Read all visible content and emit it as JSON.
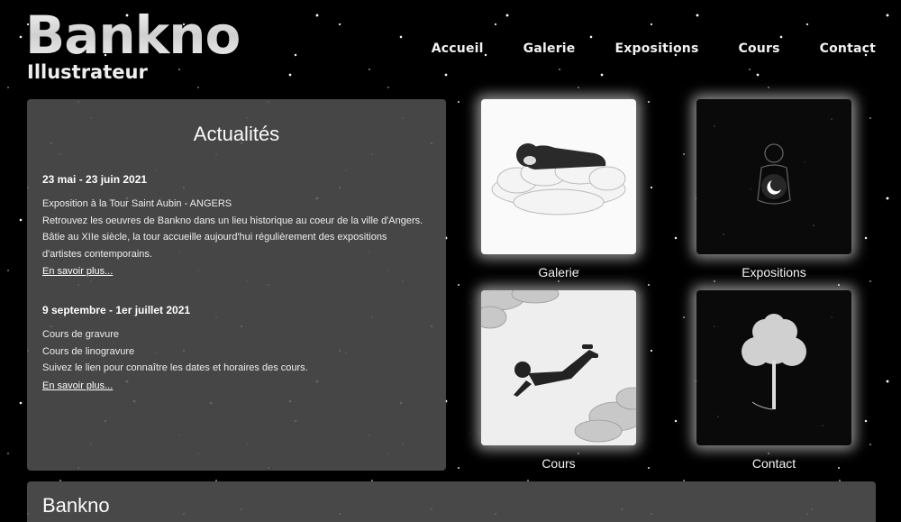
{
  "header": {
    "title": "Bankno",
    "subtitle": "Illustrateur"
  },
  "nav": {
    "items": [
      {
        "label": "Accueil"
      },
      {
        "label": "Galerie"
      },
      {
        "label": "Expositions"
      },
      {
        "label": "Cours"
      },
      {
        "label": "Contact"
      }
    ]
  },
  "news": {
    "heading": "Actualités",
    "items": [
      {
        "date": "23 mai - 23 juin 2021",
        "lines": [
          "Exposition à la Tour Saint Aubin - ANGERS",
          "Retrouvez les oeuvres de Bankno dans un lieu historique au coeur de la ville d'Angers.",
          "Bâtie au XIIe siècle, la tour accueille aujourd'hui régulièrement des expositions",
          "d'artistes contemporains."
        ],
        "link": "En savoir plus..."
      },
      {
        "date": "9 septembre - 1er juillet 2021",
        "lines": [
          "Cours de gravure",
          "Cours de linogravure",
          "Suivez le lien pour connaître les dates et horaires des cours."
        ],
        "link": "En savoir plus..."
      }
    ]
  },
  "tiles": [
    {
      "caption": "Galerie",
      "image": "sleeping-on-cloud-illustration"
    },
    {
      "caption": "Expositions",
      "image": "figure-with-moon-illustration"
    },
    {
      "caption": "Cours",
      "image": "flying-boy-illustration"
    },
    {
      "caption": "Contact",
      "image": "glowing-tree-illustration"
    }
  ],
  "footer": {
    "title": "Bankno"
  },
  "colors": {
    "background": "#000000",
    "panel": "#505050",
    "text": "#ffffff"
  }
}
